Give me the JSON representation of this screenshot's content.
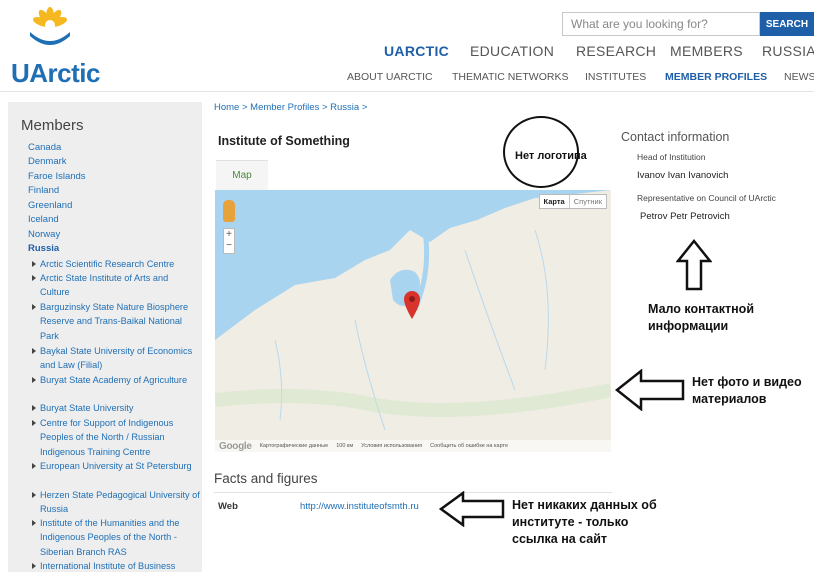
{
  "brand": {
    "name": "UArctic",
    "logo_icon": "sun-flower-logo-icon",
    "colors": {
      "primary": "#1f5fa8",
      "link": "#1f6fb5",
      "logo_petals": "#f5b820"
    }
  },
  "search": {
    "placeholder": "What are you looking for?",
    "button_label": "SEARCH"
  },
  "nav_primary": [
    {
      "label": "UARCTIC",
      "active": true
    },
    {
      "label": "EDUCATION",
      "active": false
    },
    {
      "label": "RESEARCH",
      "active": false
    },
    {
      "label": "MEMBERS",
      "active": false
    },
    {
      "label": "RUSSIAN",
      "active": false
    }
  ],
  "nav_secondary": [
    {
      "label": "ABOUT UARCTIC",
      "active": false
    },
    {
      "label": "THEMATIC NETWORKS",
      "active": false
    },
    {
      "label": "INSTITUTES",
      "active": false
    },
    {
      "label": "MEMBER PROFILES",
      "active": true
    },
    {
      "label": "NEWS",
      "active": false
    }
  ],
  "sidebar": {
    "title": "Members",
    "countries": [
      "Canada",
      "Denmark",
      "Faroe Islands",
      "Finland",
      "Greenland",
      "Iceland",
      "Norway",
      "Russia"
    ],
    "active_country": "Russia",
    "institutions": [
      "Arctic Scientific Research Centre",
      "Arctic State Institute of Arts and Culture",
      "Barguzinsky State Nature Biosphere Reserve and Trans-Baikal National Park",
      "Baykal State University of Economics and Law (Filial)",
      "Buryat State Academy of Agriculture",
      "Buryat State University",
      "Centre for Support of Indigenous Peoples of the North / Russian Indigenous Training Centre",
      "European University at St Petersburg",
      "Herzen State Pedagogical University of Russia",
      "Institute of the Humanities and the Indigenous Peoples of the North - Siberian Branch RAS",
      "International Institute of Business"
    ]
  },
  "breadcrumb": "Home >  Member Profiles >  Russia >",
  "institute": {
    "title": "Institute of Something",
    "map_tab": "Map",
    "map": {
      "type_selected": "Карта",
      "type_other": "Спутник",
      "zoom_in": "+",
      "zoom_out": "−",
      "logo": "Google",
      "footer_data": "Картографические данные",
      "footer_scale": "100 км",
      "footer_terms": "Условия использования",
      "footer_report": "Сообщить об ошибке на карте",
      "marker_color": "#d9342b",
      "water_color": "#a9d4ef",
      "land_color": "#f0ede5"
    }
  },
  "facts": {
    "title": "Facts and figures",
    "web_label": "Web",
    "web_value": "http://www.instituteofsmth.ru"
  },
  "contact": {
    "title": "Contact information",
    "head_label": "Head of Institution",
    "head_name": "Ivanov Ivan Ivanovich",
    "rep_label": "Representative on Council of UArctic",
    "rep_name": "Petrov Petr Petrovich"
  },
  "annotations": {
    "no_logo": "Нет логотипа",
    "little_contact_1": "Мало контактной",
    "little_contact_2": "информации",
    "no_media_1": "Нет фото и видео",
    "no_media_2": "материалов",
    "no_data_1": "Нет никаких данных об",
    "no_data_2": "институте - только",
    "no_data_3": "ссылка на сайт"
  }
}
